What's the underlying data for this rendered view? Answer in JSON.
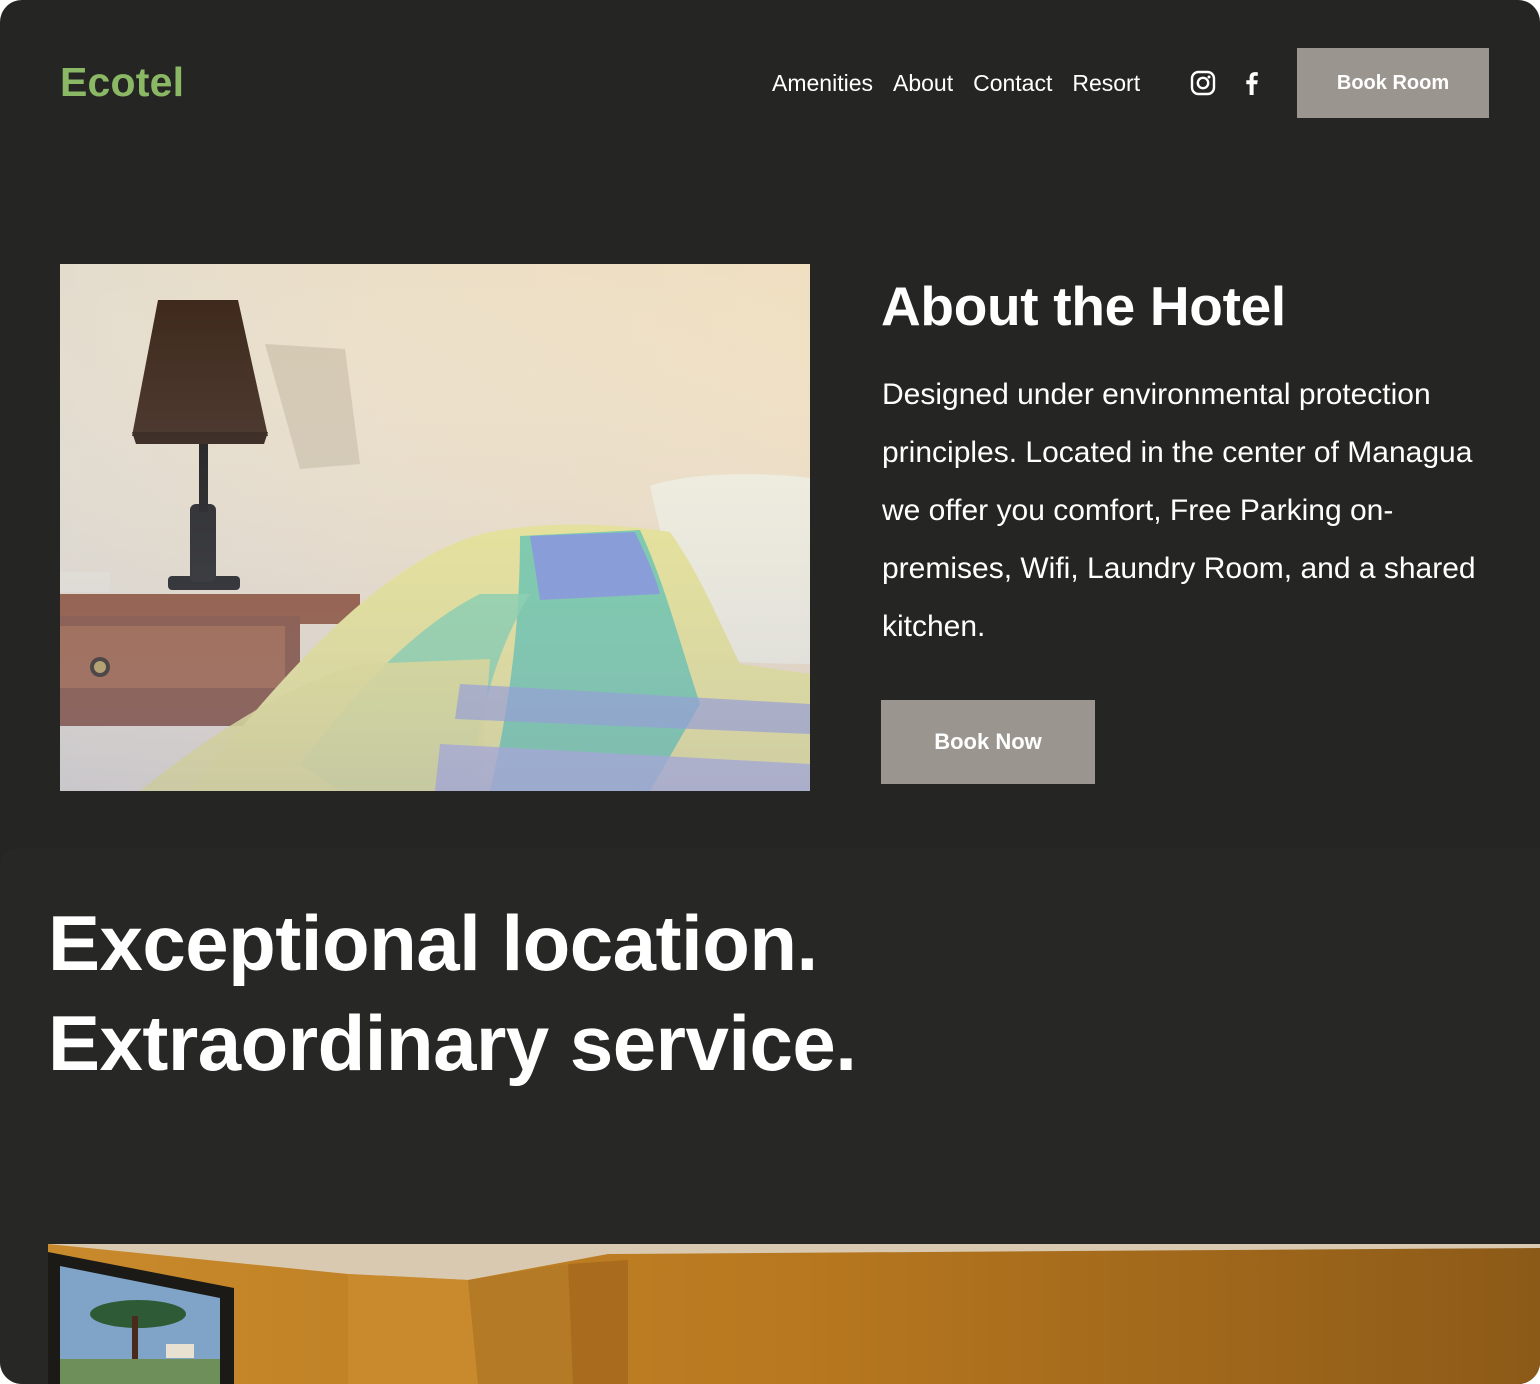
{
  "header": {
    "logo": "Ecotel",
    "nav": [
      "Amenities",
      "About",
      "Contact",
      "Resort"
    ],
    "social_icons": [
      "instagram-icon",
      "facebook-icon"
    ],
    "cta_label": "Book Room"
  },
  "about": {
    "title": "About the Hotel",
    "body": "Designed under environmental protection principles. Located in the center of Managua we offer you comfort, Free Parking on-premises, Wifi, Laundry Room, and a shared kitchen.",
    "cta_label": "Book Now",
    "image_subject": "bedroom-with-lamp-and-bed"
  },
  "tagline": {
    "text": "Exceptional location. Extraordinary service."
  },
  "gallery": {
    "image_subject": "room-with-framed-painting"
  },
  "colors": {
    "background": "#252523",
    "logo": "#8bb865",
    "button": "#9a968f",
    "text": "#ffffff"
  }
}
